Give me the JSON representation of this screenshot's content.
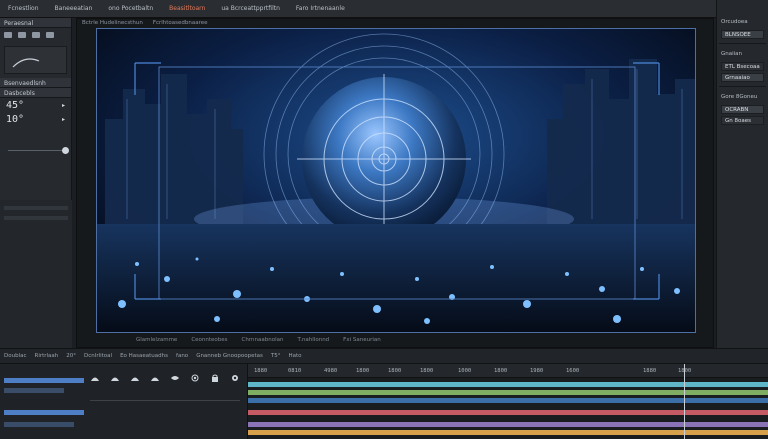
{
  "colors": {
    "accent": "#e27a5a",
    "canvas_border": "#4d6fa3",
    "track_colors": [
      "#5fb6c9",
      "#7fae62",
      "#c45a63",
      "#8b73b8",
      "#d7a04a"
    ]
  },
  "menubar": {
    "items": [
      "Fcnestlion",
      "Baneeeatian",
      "ono Pocetbaltn",
      "Beasitltoarn",
      "ua Bcrceattpprtfiltn",
      "Faro Irtnenaanle"
    ],
    "accent_index": 3
  },
  "viewer": {
    "tabs": [
      "Bctrle Hudelinecsthun",
      "Fcrlhtoasedbnaaree"
    ],
    "status": [
      "Glamlelzamme",
      "Ceonnteobes",
      "Chrnnaabnolan",
      "T.nahllonnd",
      "Fxi Saneurian"
    ]
  },
  "left_panel": {
    "head": "Peraesnal",
    "sections": [
      "Bsenvaedlsnh",
      "Dasbcebls"
    ],
    "dial_values": [
      "45°",
      "10°"
    ]
  },
  "right_panel": {
    "title": "Orcudoea",
    "field1": "BLNSOEE",
    "section2": "Gnaiian",
    "field2": "ETL Bsecoaa",
    "field3": "Grnaaiao",
    "section3": "Gore 8Goneu",
    "field4": "OCRABN",
    "field5": "Gn 8oaes"
  },
  "transport": {
    "items": [
      "Doublac",
      "Rirtrlaah",
      "20°",
      "Dcnlrlitoal",
      "Eo Hasaeatuadhs",
      "fano",
      "Gnanneb Gnoopoopetas",
      "T5°",
      "Hato"
    ]
  },
  "timeline": {
    "ruler_labels": [
      "1880",
      "0810",
      "4980",
      "1800",
      "1800",
      "1800",
      "1000",
      "1800",
      "1980",
      "1600",
      "1880",
      "1800"
    ]
  },
  "icons": [
    "playhead-marker",
    "keyframe-icon",
    "eye-icon",
    "lock-icon",
    "solo-icon",
    "gear-icon"
  ]
}
